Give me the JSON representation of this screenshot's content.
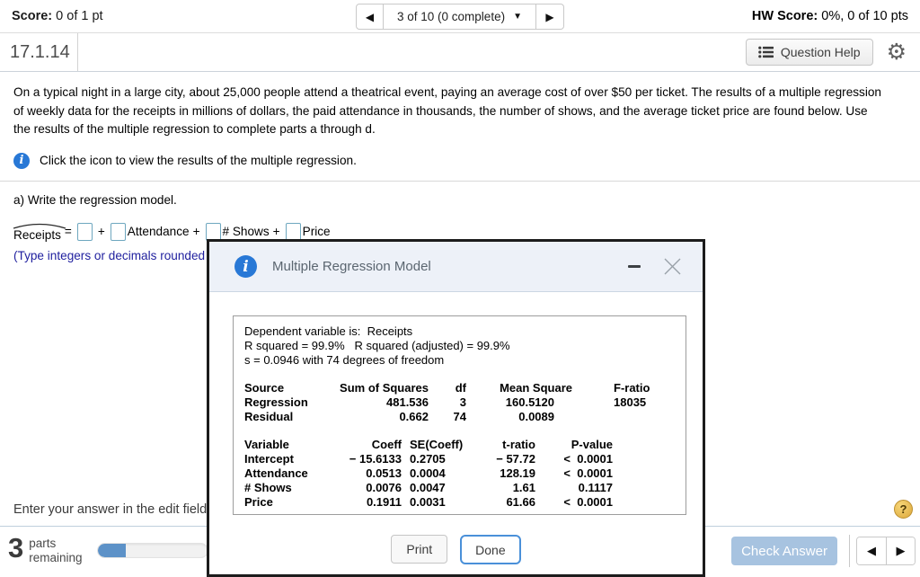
{
  "top_bar": {
    "score_label": "Score:",
    "score_value": " 0 of 1 pt",
    "nav": {
      "prev_icon": "◀",
      "label": "3 of 10 (0 complete)",
      "caret_icon": "▼",
      "next_icon": "▶"
    },
    "hw_score_label": "HW Score:",
    "hw_score_value": " 0%, 0 of 10 pts"
  },
  "question_bar": {
    "question_id": "17.1.14",
    "question_help_label": "Question Help",
    "gear_icon": "⚙"
  },
  "problem": {
    "text": "On a typical night in a large city, about 25,000 people attend a theatrical event, paying an average cost of over $50 per ticket. The results of a multiple regression of weekly data for the receipts in millions of dollars, the paid attendance in thousands, the number of shows, and the average ticket price are found below. Use the results of the multiple regression to complete parts a through d.",
    "info_icon": "i",
    "icon_note": "Click the icon to view the results of the multiple regression."
  },
  "part_a": {
    "prompt": "a) Write the regression model.",
    "formula": {
      "lhs": "Receipts",
      "equals": "=",
      "plus": "+",
      "term2_label": "Attendance",
      "term3_label": "# Shows",
      "term4_label": "Price"
    },
    "note": "(Type integers or decimals rounded to four decimal places as needed.)"
  },
  "modal": {
    "info_icon": "i",
    "title": "Multiple Regression Model",
    "summary_lines": [
      "Dependent variable is:  Receipts",
      "R squared = 99.9%   R squared (adjusted) = 99.9%",
      "s = 0.0946 with 74 degrees of freedom"
    ],
    "anova": {
      "headers": [
        "Source",
        "Sum of Squares",
        "df",
        "Mean Square",
        "F-ratio"
      ],
      "rows": [
        [
          "Regression",
          "481.536",
          "3",
          "160.5120",
          "18035"
        ],
        [
          "Residual",
          "0.662",
          "74",
          "0.0089",
          ""
        ]
      ]
    },
    "coefficients": {
      "headers": [
        "Variable",
        "Coeff",
        "SE(Coeff)",
        "t-ratio",
        "P-value"
      ],
      "rows": [
        [
          "Intercept",
          "− 15.6133",
          "0.2705",
          "− 57.72",
          "<  0.0001"
        ],
        [
          "Attendance",
          "0.0513",
          "0.0004",
          "128.19",
          "<  0.0001"
        ],
        [
          "# Shows",
          "0.0076",
          "0.0047",
          "1.61",
          "0.1117"
        ],
        [
          "Price",
          "0.1911",
          "0.0031",
          "61.66",
          "<  0.0001"
        ]
      ]
    },
    "print_label": "Print",
    "done_label": "Done"
  },
  "footer": {
    "answer_hint": "Enter your answer in the edit fields",
    "parts_remaining_count": "3",
    "parts_label_line1": "parts",
    "parts_label_line2": "remaining",
    "progress_percent": 25,
    "check_answer_label": "Check Answer",
    "help_icon": "?",
    "prev_icon": "◀",
    "next_icon": "▶"
  },
  "colors": {
    "accent_blue": "#2878d6",
    "progress_fill": "#5d92c8",
    "check_button_bg": "#a7c3e0",
    "done_border": "#4a90d9",
    "note_blue": "#21219f",
    "answer_box_border": "#6ea7bf",
    "help_gold": "#dca83c"
  }
}
